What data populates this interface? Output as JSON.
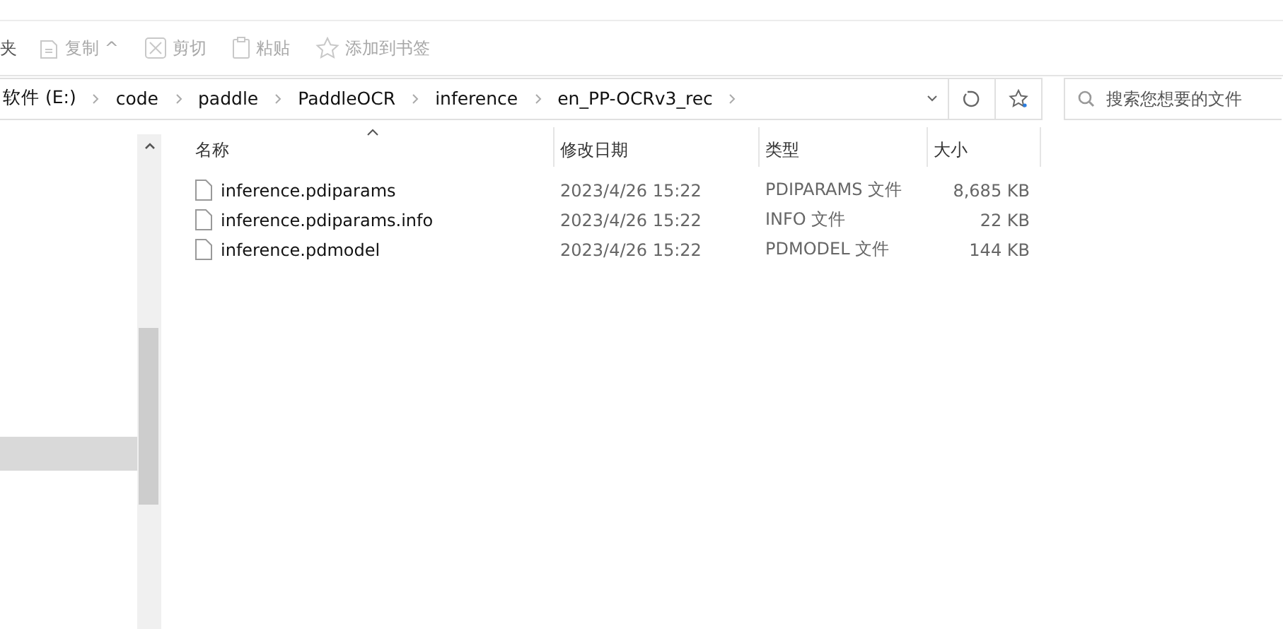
{
  "toolbar": {
    "cut_label": "夹",
    "buttons": [
      {
        "kind": "copy",
        "label": "复制",
        "caret": "^",
        "disabled": true
      },
      {
        "kind": "cut",
        "label": "剪切",
        "disabled": true
      },
      {
        "kind": "paste",
        "label": "粘贴",
        "disabled": true
      },
      {
        "kind": "bookmark",
        "label": "添加到书签",
        "disabled": true
      }
    ]
  },
  "address_bar": {
    "breadcrumbs": [
      "软件 (E:)",
      "code",
      "paddle",
      "PaddleOCR",
      "inference",
      "en_PP-OCRv3_rec"
    ]
  },
  "search": {
    "placeholder": "搜索您想要的文件"
  },
  "table": {
    "columns": [
      {
        "label": "名称",
        "sorted": true
      },
      {
        "label": "修改日期",
        "sorted": false
      },
      {
        "label": "类型",
        "sorted": false
      },
      {
        "label": "大小",
        "sorted": false
      }
    ],
    "rows": [
      {
        "name": "inference.pdiparams",
        "modified": "2023/4/26 15:22",
        "type": "PDIPARAMS 文件",
        "size": "8,685 KB"
      },
      {
        "name": "inference.pdiparams.info",
        "modified": "2023/4/26 15:22",
        "type": "INFO 文件",
        "size": "22 KB"
      },
      {
        "name": "inference.pdmodel",
        "modified": "2023/4/26 15:22",
        "type": "PDMODEL 文件",
        "size": "144 KB"
      }
    ]
  }
}
